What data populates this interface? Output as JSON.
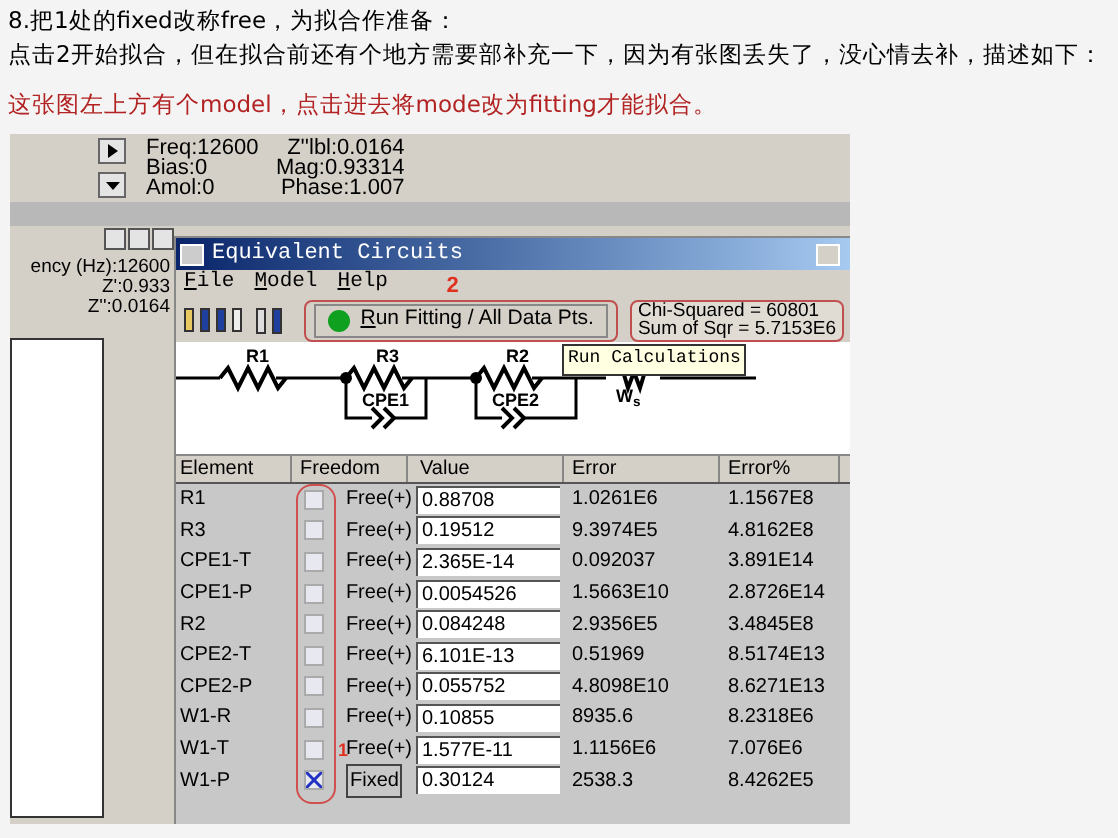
{
  "article": {
    "lines": [
      "8.把1处的fixed改称free，为拟合作准备：",
      "点击2开始拟合，但在拟合前还有个地方需要部补充一下，因为有张图丢失了，没心情去补，描述如下："
    ],
    "note": "这张图左上方有个model，点击进去将mode改为fitting才能拟合。"
  },
  "screenshot": {
    "back_window": {
      "readings_left": [
        "Freq:12600",
        "Bias:0",
        "Amol:0"
      ],
      "readings_right": [
        "Z''lbl:0.0164",
        "Mag:0.93314",
        "Phase:1.007"
      ],
      "side_readings": [
        "ency (Hz):12600",
        "Z':0.933",
        "Z'':0.0164"
      ]
    },
    "window": {
      "title": "Equivalent Circuits",
      "menu": [
        "File",
        "Model",
        "Help"
      ],
      "callout_run": "2",
      "run_button": "Run Fitting / All Data Pts.",
      "stats": [
        "Chi-Squared = 60801",
        "Sum of Sqr = 5.7153E6"
      ],
      "tooltip": "Run Calculations",
      "circuit_labels": [
        "R1",
        "R3",
        "CPE1",
        "R2",
        "CPE2",
        "W$_{s}$"
      ],
      "table": {
        "columns": [
          "Element",
          "Freedom",
          "Value",
          "Error",
          "Error%"
        ],
        "callout_fixed": "1",
        "rows": [
          {
            "element": "R1",
            "fixed": false,
            "freedom": "Free(+)",
            "value": "0.88708",
            "error": "1.0261E6",
            "error_pct": "1.1567E8"
          },
          {
            "element": "R3",
            "fixed": false,
            "freedom": "Free(+)",
            "value": "0.19512",
            "error": "9.3974E5",
            "error_pct": "4.8162E8"
          },
          {
            "element": "CPE1-T",
            "fixed": false,
            "freedom": "Free(+)",
            "value": "2.365E-14",
            "error": "0.092037",
            "error_pct": "3.891E14"
          },
          {
            "element": "CPE1-P",
            "fixed": false,
            "freedom": "Free(+)",
            "value": "0.0054526",
            "error": "1.5663E10",
            "error_pct": "2.8726E14"
          },
          {
            "element": "R2",
            "fixed": false,
            "freedom": "Free(+)",
            "value": "0.084248",
            "error": "2.9356E5",
            "error_pct": "3.4845E8"
          },
          {
            "element": "CPE2-T",
            "fixed": false,
            "freedom": "Free(+)",
            "value": "6.101E-13",
            "error": "0.51969",
            "error_pct": "8.5174E13"
          },
          {
            "element": "CPE2-P",
            "fixed": false,
            "freedom": "Free(+)",
            "value": "0.055752",
            "error": "4.8098E10",
            "error_pct": "8.6271E13"
          },
          {
            "element": "W1-R",
            "fixed": false,
            "freedom": "Free(+)",
            "value": "0.10855",
            "error": "8935.6",
            "error_pct": "8.2318E6"
          },
          {
            "element": "W1-T",
            "fixed": false,
            "freedom": "Free(+)",
            "value": "1.577E-11",
            "error": "1.1156E6",
            "error_pct": "7.076E6"
          },
          {
            "element": "W1-P",
            "fixed": true,
            "freedom": "Fixed",
            "value": "0.30124",
            "error": "2538.3",
            "error_pct": "8.4262E5"
          }
        ]
      }
    }
  }
}
